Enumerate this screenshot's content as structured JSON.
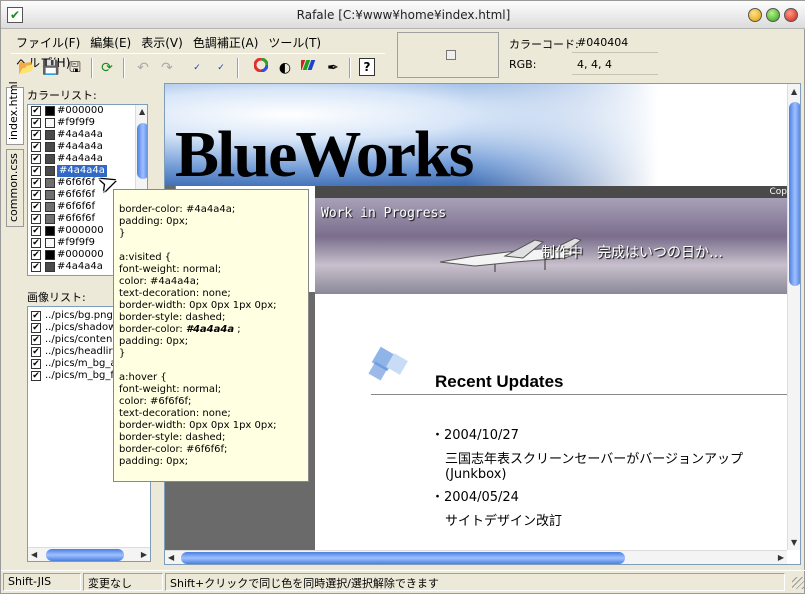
{
  "window": {
    "title": "Rafale [C:¥www¥home¥index.html]"
  },
  "menu": [
    "ファイル(F)",
    "編集(E)",
    "表示(V)",
    "色調補正(A)",
    "ツール(T)",
    "ヘルプ(H)"
  ],
  "color_info": {
    "code_label": "カラーコード:",
    "code_value": "#040404",
    "rgb_label": "RGB:",
    "rgb_value": "4, 4, 4"
  },
  "tabs": [
    "index.html",
    "common.css"
  ],
  "color_list": {
    "label": "カラーリスト:",
    "selected_index": 5,
    "items": [
      {
        "hex": "#000000",
        "color": "#000000"
      },
      {
        "hex": "#f9f9f9",
        "color": "#f9f9f9"
      },
      {
        "hex": "#4a4a4a",
        "color": "#4a4a4a"
      },
      {
        "hex": "#4a4a4a",
        "color": "#4a4a4a"
      },
      {
        "hex": "#4a4a4a",
        "color": "#4a4a4a"
      },
      {
        "hex": "#4a4a4a",
        "color": "#4a4a4a"
      },
      {
        "hex": "#6f6f6f",
        "color": "#6f6f6f"
      },
      {
        "hex": "#6f6f6f",
        "color": "#6f6f6f"
      },
      {
        "hex": "#6f6f6f",
        "color": "#6f6f6f"
      },
      {
        "hex": "#6f6f6f",
        "color": "#6f6f6f"
      },
      {
        "hex": "#000000",
        "color": "#000000"
      },
      {
        "hex": "#f9f9f9",
        "color": "#f9f9f9"
      },
      {
        "hex": "#000000",
        "color": "#000000"
      },
      {
        "hex": "#4a4a4a",
        "color": "#4a4a4a"
      }
    ]
  },
  "image_list": {
    "label": "画像リスト:",
    "items": [
      "../pics/bg.png",
      "../pics/shadow",
      "../pics/conten",
      "../pics/headlir",
      "../pics/m_bg_a",
      "../pics/m_bg_f"
    ]
  },
  "tooltip": {
    "lines_1": "border-color: #4a4a4a;\npadding: 0px;\n}\n\na:visited {\nfont-weight: normal;\ncolor: #4a4a4a;\ntext-decoration: none;\nborder-width: 0px 0px 1px 0px;\nborder-style: dashed;",
    "highlight_prefix": "border-color: ",
    "highlight": "#4a4a4a",
    "highlight_suffix": " ;",
    "lines_2": "padding: 0px;\n}\n\na:hover {\nfont-weight: normal;\ncolor: #6f6f6f;\ntext-decoration: none;\nborder-width: 0px 0px 1px 0px;\nborder-style: dashed;\nborder-color: #6f6f6f;\npadding: 0px;"
  },
  "page": {
    "site_title": "BlueWorks",
    "copy": "Cop",
    "banner_title": "Work in Progress",
    "banner_text": "制作中　完成はいつの日か…",
    "updates_heading": "Recent Updates",
    "updates": [
      {
        "date": "・2004/10/27",
        "text": "三国志年表スクリーンセーバーがバージョンアップ(Junkbox)"
      },
      {
        "date": "・2004/05/24",
        "text": "サイトデザイン改訂"
      }
    ]
  },
  "status": {
    "encoding": "Shift-JIS",
    "state": "変更なし",
    "hint": "Shift+クリックで同じ色を同時選択/選択解除できます"
  },
  "colors": {
    "selection": "#316ac5",
    "scroll": "#4b7fe0"
  }
}
